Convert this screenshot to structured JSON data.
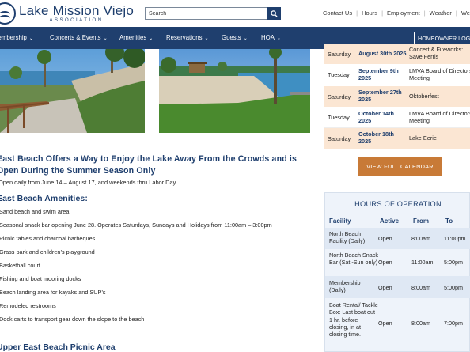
{
  "header": {
    "logo_name": "Lake Mission Viejo",
    "logo_sub": "ASSOCIATION",
    "search_placeholder": "Search",
    "top_links": [
      "Contact Us",
      "Hours",
      "Employment",
      "Weather",
      "Webcam"
    ]
  },
  "nav": {
    "items": [
      "Membership",
      "Concerts & Events",
      "Amenities",
      "Reservations",
      "Guests",
      "HOA"
    ],
    "homeowner_login": "HOMEOWNER LOGIN"
  },
  "article": {
    "title": "East Beach Offers a Way to Enjoy the Lake Away From the Crowds and is Open During the Summer Season Only",
    "hours_line": "Open daily from June 14 – August 17, and weekends thru Labor Day.",
    "amenities_heading": "East Beach Amenities:",
    "amenities": [
      "Sand beach and swim area",
      "Seasonal snack bar opening June 28.  Operates Saturdays, Sundays and Holidays from 11:00am – 3:00pm",
      "Picnic tables and charcoal barbeques",
      "Grass park and children’s playground",
      "Basketball court",
      "Fishing and boat mooring docks",
      "Beach landing area for kayaks and SUP’s",
      "Remodeled restrooms",
      "Dock carts to transport gear down the slope to the beach"
    ],
    "next_heading": "Upper East Beach Picnic Area"
  },
  "events": {
    "rows": [
      {
        "day": "Saturday",
        "date": "August 30th 2025",
        "title": "Concert & Fireworks: Save Ferris"
      },
      {
        "day": "Tuesday",
        "date": "September 9th 2025",
        "title": "LMVA Board of Directors Meeting"
      },
      {
        "day": "Saturday",
        "date": "September 27th 2025",
        "title": "Oktoberfest"
      },
      {
        "day": "Tuesday",
        "date": "October 14th 2025",
        "title": "LMVA Board of Directors Meeting"
      },
      {
        "day": "Saturday",
        "date": "October 18th 2025",
        "title": "Lake Eerie"
      }
    ],
    "button_label": "VIEW FULL CALENDAR"
  },
  "hours": {
    "title": "HOURS OF OPERATION",
    "headers": [
      "Facility",
      "Active",
      "From",
      "To"
    ],
    "rows": [
      {
        "facility": "North Beach Facility (Daily)",
        "active": "Open",
        "from": "8:00am",
        "to": "11:00pm"
      },
      {
        "facility": "North Beach Snack Bar (Sat.-Sun only)",
        "active": "Open",
        "from": "11:00am",
        "to": "5:00pm"
      },
      {
        "facility": "Membership (Daily)",
        "active": "Open",
        "from": "8:00am",
        "to": "5:00pm"
      },
      {
        "facility": "Boat Rental/ Tackle Box: Last boat out 1 hr. before closing, in at closing time.",
        "active": "Open",
        "from": "8:00am",
        "to": "7:00pm"
      }
    ]
  },
  "colors": {
    "brand_navy": "#1f3f6e",
    "accent_orange": "#c87a37",
    "event_highlight": "#fbe6d3",
    "hours_bg": "#eef3fa"
  }
}
